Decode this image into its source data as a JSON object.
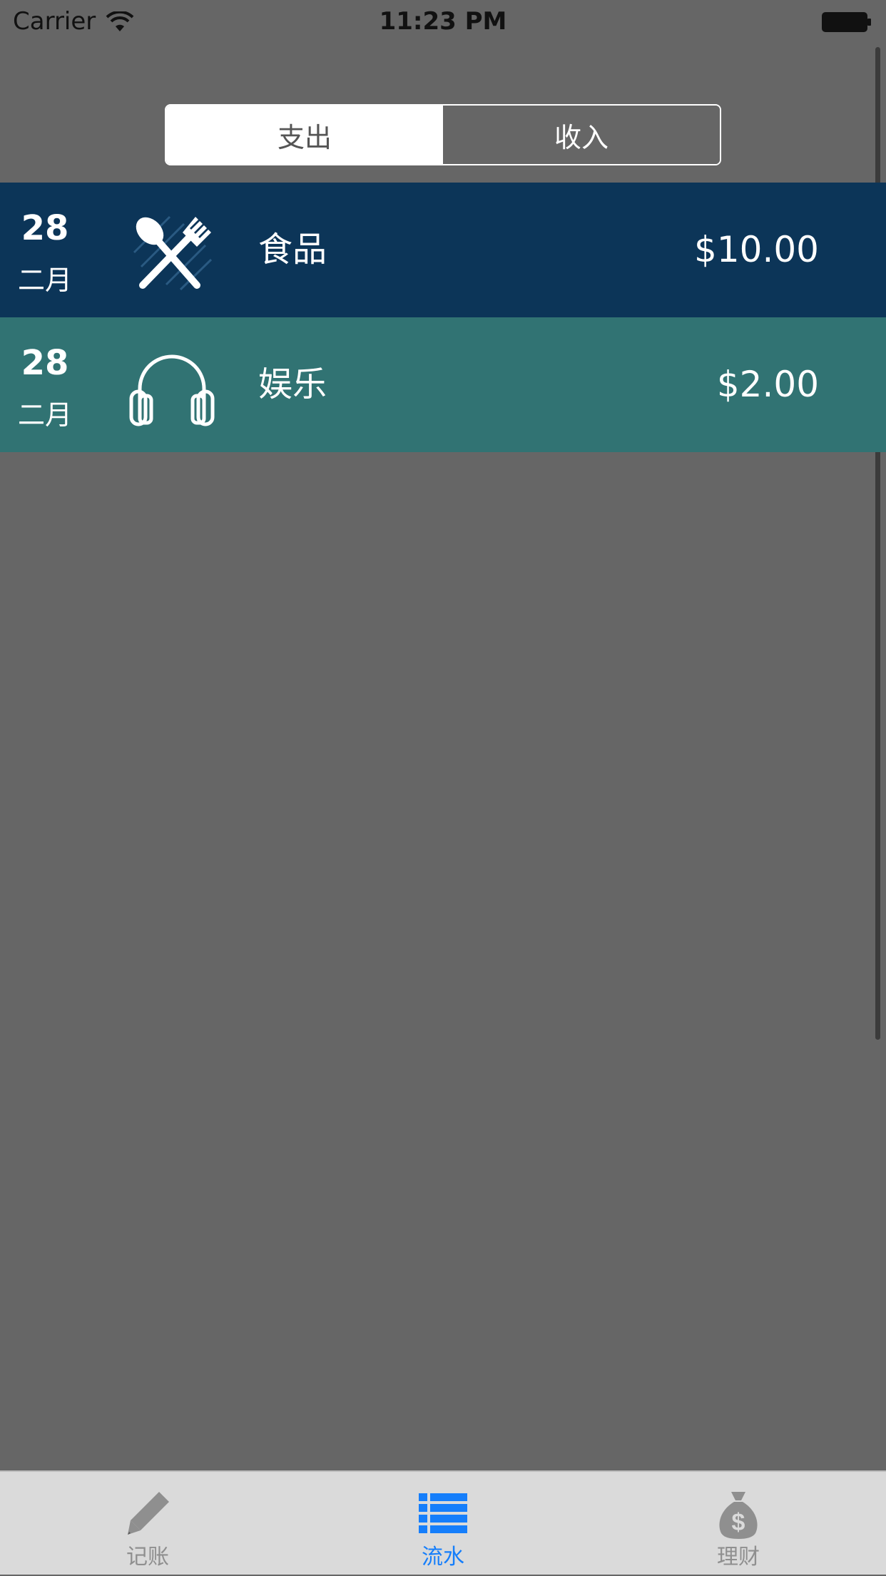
{
  "status_bar": {
    "carrier": "Carrier",
    "time": "11:23 PM",
    "wifi_icon": "wifi-icon",
    "battery_icon": "battery-icon"
  },
  "segmented_control": {
    "segments": [
      {
        "label": "支出",
        "selected": true
      },
      {
        "label": "收入",
        "selected": false
      }
    ]
  },
  "transactions": [
    {
      "day": "28",
      "month": "二月",
      "icon": "fork-spoon-icon",
      "category": "食品",
      "amount": "$10.00",
      "color": "#0c3558"
    },
    {
      "day": "28",
      "month": "二月",
      "icon": "headphones-icon",
      "category": "娱乐",
      "amount": "$2.00",
      "color": "#317373"
    }
  ],
  "tab_bar": {
    "tabs": [
      {
        "label": "记账",
        "icon": "pencil-icon",
        "active": false
      },
      {
        "label": "流水",
        "icon": "list-icon",
        "active": true
      },
      {
        "label": "理财",
        "icon": "money-bag-icon",
        "active": false
      }
    ]
  },
  "colors": {
    "background": "#666666",
    "accent": "#157efb",
    "tab_inactive": "#8f8f8f"
  }
}
